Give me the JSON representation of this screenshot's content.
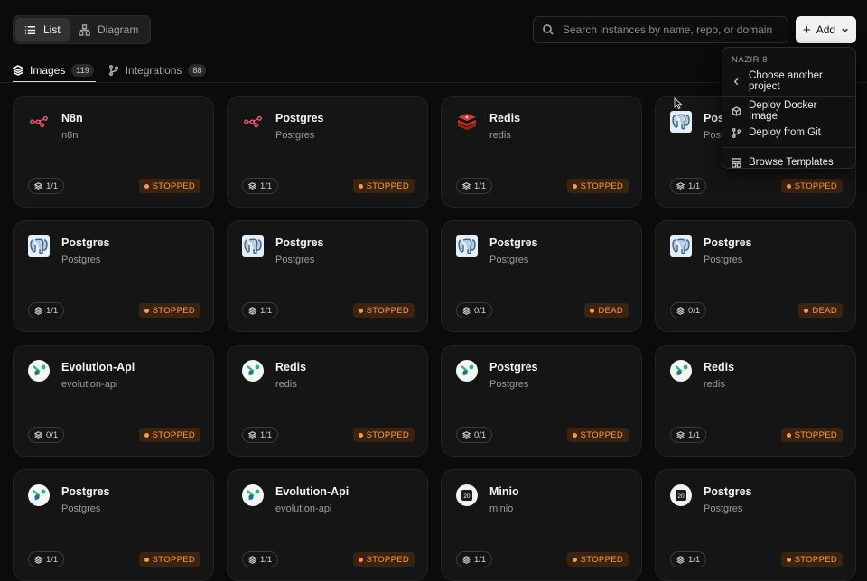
{
  "view_toggle": {
    "list_label": "List",
    "diagram_label": "Diagram",
    "selected": "List"
  },
  "search": {
    "placeholder": "Search instances by name, repo, or domain",
    "value": ""
  },
  "add_button": {
    "label": "Add"
  },
  "tabs": [
    {
      "label": "Images",
      "count": "119",
      "active": true,
      "icon": "layers-icon"
    },
    {
      "label": "Integrations",
      "count": "88",
      "active": false,
      "icon": "git-branch-icon"
    }
  ],
  "add_menu": {
    "heading": "NAZIR 8",
    "back_item": "Choose another project",
    "items": [
      {
        "label": "Deploy Docker Image",
        "icon": "package-icon"
      },
      {
        "label": "Deploy from Git",
        "icon": "git-branch-icon"
      }
    ],
    "footer_item": {
      "label": "Browse Templates",
      "icon": "template-icon"
    }
  },
  "colors": {
    "status_text": "#ff9a3c",
    "status_bg": "#3a2410",
    "card_bg": "#151515",
    "page_bg": "#0b0b0b"
  },
  "cards": [
    {
      "name": "N8n",
      "sub": "n8n",
      "replicas": "1/1",
      "status": "STOPPED",
      "logo": "n8n-icon"
    },
    {
      "name": "Postgres",
      "sub": "Postgres",
      "replicas": "1/1",
      "status": "STOPPED",
      "logo": "n8n-icon"
    },
    {
      "name": "Redis",
      "sub": "redis",
      "replicas": "1/1",
      "status": "STOPPED",
      "logo": "redis-icon"
    },
    {
      "name": "Postgres",
      "sub": "Postgres",
      "replicas": "1/1",
      "status": "STOPPED",
      "logo": "postgres-icon"
    },
    {
      "name": "Postgres",
      "sub": "Postgres",
      "replicas": "1/1",
      "status": "STOPPED",
      "logo": "postgres-icon"
    },
    {
      "name": "Postgres",
      "sub": "Postgres",
      "replicas": "1/1",
      "status": "STOPPED",
      "logo": "postgres-icon"
    },
    {
      "name": "Postgres",
      "sub": "Postgres",
      "replicas": "0/1",
      "status": "DEAD",
      "logo": "postgres-icon"
    },
    {
      "name": "Postgres",
      "sub": "Postgres",
      "replicas": "0/1",
      "status": "DEAD",
      "logo": "postgres-icon"
    },
    {
      "name": "Evolution-Api",
      "sub": "evolution-api",
      "replicas": "0/1",
      "status": "STOPPED",
      "logo": "evolution-icon"
    },
    {
      "name": "Redis",
      "sub": "redis",
      "replicas": "1/1",
      "status": "STOPPED",
      "logo": "evolution-icon"
    },
    {
      "name": "Postgres",
      "sub": "Postgres",
      "replicas": "0/1",
      "status": "STOPPED",
      "logo": "evolution-icon"
    },
    {
      "name": "Redis",
      "sub": "redis",
      "replicas": "1/1",
      "status": "STOPPED",
      "logo": "evolution-icon"
    },
    {
      "name": "Postgres",
      "sub": "Postgres",
      "replicas": "1/1",
      "status": "STOPPED",
      "logo": "evolution-icon"
    },
    {
      "name": "Evolution-Api",
      "sub": "evolution-api",
      "replicas": "1/1",
      "status": "STOPPED",
      "logo": "evolution-icon"
    },
    {
      "name": "Minio",
      "sub": "minio",
      "replicas": "1/1",
      "status": "STOPPED",
      "logo": "minio-icon"
    },
    {
      "name": "Postgres",
      "sub": "Postgres",
      "replicas": "1/1",
      "status": "STOPPED",
      "logo": "minio-icon"
    }
  ]
}
